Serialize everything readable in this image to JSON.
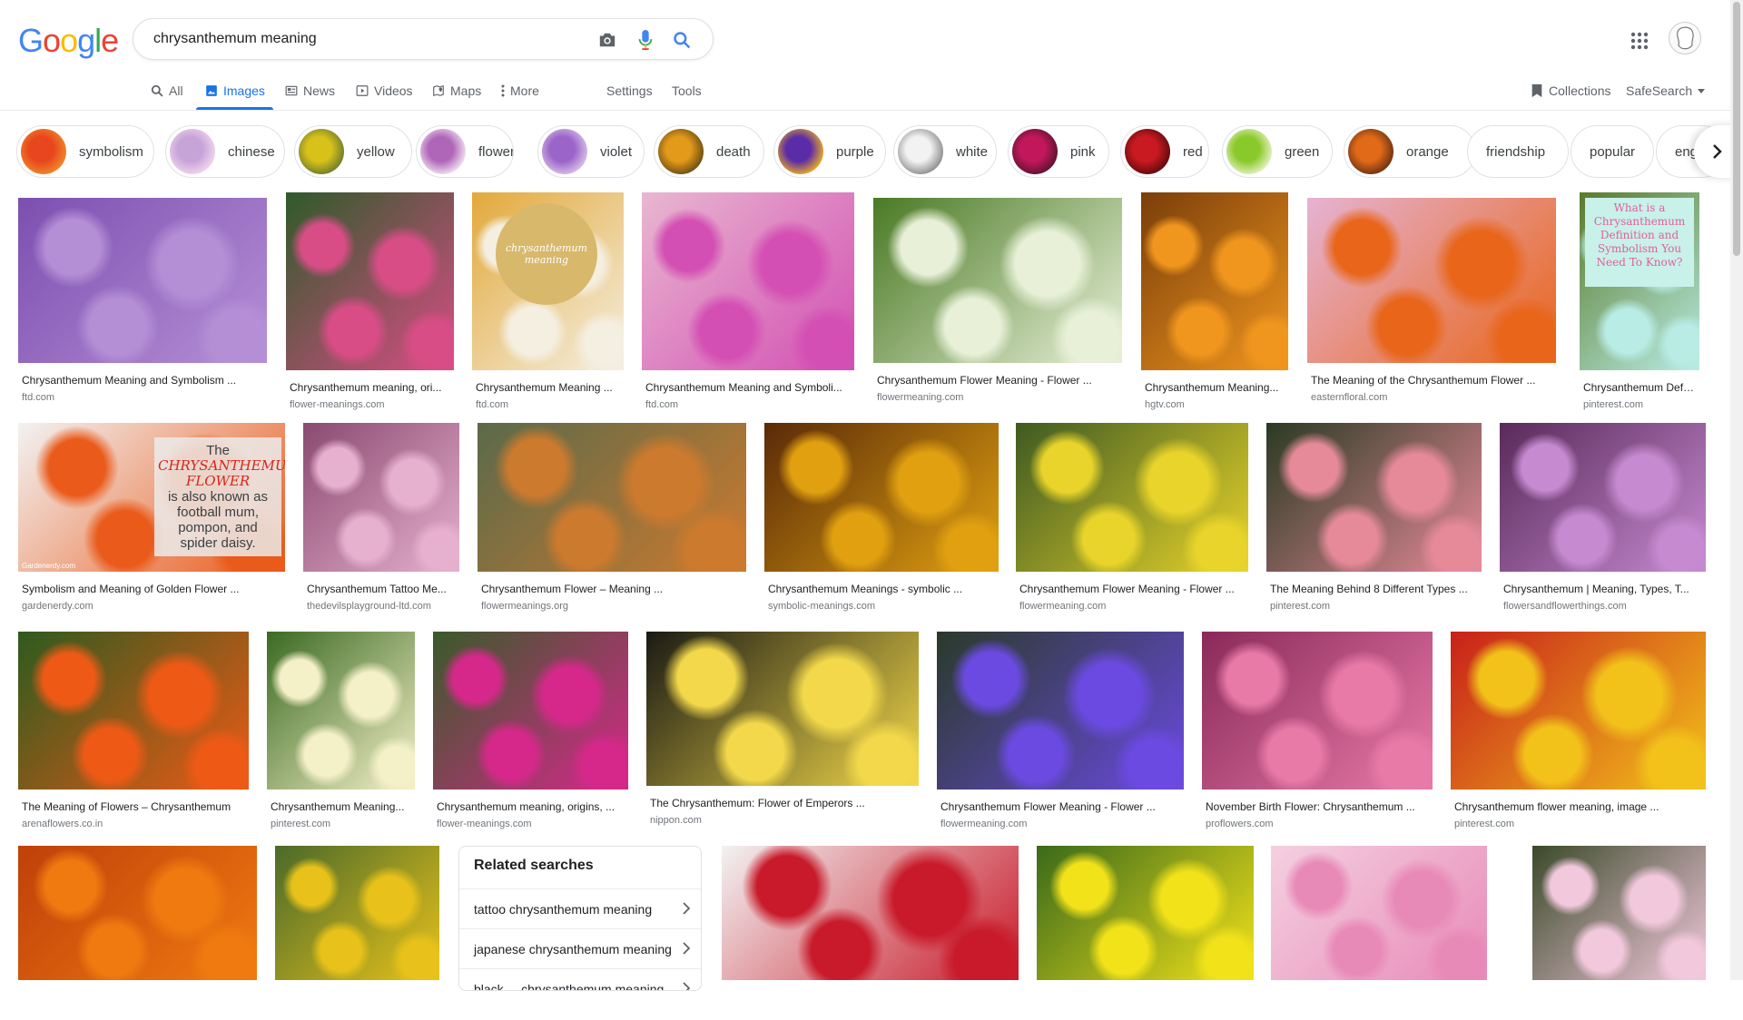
{
  "logo": {
    "letters": [
      "G",
      "o",
      "o",
      "g",
      "l",
      "e"
    ],
    "colors": [
      "#4285f4",
      "#ea4335",
      "#fbbc05",
      "#4285f4",
      "#34a853",
      "#ea4335"
    ]
  },
  "search": {
    "query": "chrysanthemum meaning",
    "placeholder": ""
  },
  "icons": {
    "camera": "camera-icon",
    "mic": "mic-icon",
    "search": "search-icon",
    "apps": "apps-grid-icon"
  },
  "tabs": [
    {
      "label": "All",
      "icon": "search-icon"
    },
    {
      "label": "Images",
      "icon": "image-icon",
      "active": true
    },
    {
      "label": "News",
      "icon": "news-icon"
    },
    {
      "label": "Videos",
      "icon": "video-icon"
    },
    {
      "label": "Maps",
      "icon": "map-icon"
    },
    {
      "label": "More",
      "icon": "more-vert-icon"
    },
    {
      "label": "Settings"
    },
    {
      "label": "Tools"
    }
  ],
  "right_tools": {
    "collections": "Collections",
    "safesearch": "SafeSearch"
  },
  "chips": [
    {
      "label": "symbolism",
      "colors": [
        "#e8461e",
        "#f08a2a"
      ]
    },
    {
      "label": "chinese",
      "colors": [
        "#c7a4d8",
        "#f2d7ee"
      ]
    },
    {
      "label": "yellow",
      "colors": [
        "#d8c21a",
        "#6c7a2a"
      ]
    },
    {
      "label": "flower",
      "colors": [
        "#b066b8",
        "#f3e6f4"
      ]
    },
    {
      "label": "violet",
      "colors": [
        "#9b64c8",
        "#d9c2ea"
      ]
    },
    {
      "label": "death",
      "colors": [
        "#e39a1a",
        "#6a4a12"
      ]
    },
    {
      "label": "purple",
      "colors": [
        "#5b2ca8",
        "#f0b020"
      ]
    },
    {
      "label": "white",
      "colors": [
        "#f2f2f2",
        "#8a8a8a"
      ]
    },
    {
      "label": "pink",
      "colors": [
        "#c2185b",
        "#5a1230"
      ]
    },
    {
      "label": "red",
      "colors": [
        "#c81a20",
        "#5b0a0e"
      ]
    },
    {
      "label": "green",
      "colors": [
        "#8ac92a",
        "#e8f2c8"
      ]
    },
    {
      "label": "orange",
      "colors": [
        "#e06a18",
        "#6a3012"
      ]
    },
    {
      "label": "friendship"
    },
    {
      "label": "popular"
    },
    {
      "label": "eng"
    }
  ],
  "results": [
    {
      "title": "Chrysanthemum Meaning and Symbolism ...",
      "source": "ftd.com",
      "colors": [
        "#b58fd6",
        "#7c4fb0"
      ]
    },
    {
      "title": "Chrysanthemum meaning, ori...",
      "source": "flower-meanings.com",
      "colors": [
        "#d94d86",
        "#2f5a2a"
      ]
    },
    {
      "title": "Chrysanthemum Meaning ...",
      "source": "ftd.com",
      "colors": [
        "#f5efe2",
        "#e2a93b"
      ]
    },
    {
      "title": "Chrysanthemum Meaning and Symboli...",
      "source": "ftd.com",
      "colors": [
        "#d34fb3",
        "#e8b7d0"
      ]
    },
    {
      "title": "Chrysanthemum Flower Meaning - Flower ...",
      "source": "flowermeaning.com",
      "colors": [
        "#e8f0d8",
        "#4a7a24"
      ]
    },
    {
      "title": "Chrysanthemum Meaning...",
      "source": "hgtv.com",
      "colors": [
        "#f0961e",
        "#7a3e0a"
      ]
    },
    {
      "title": "The Meaning of the Chrysanthemum Flower ...",
      "source": "easternfloral.com",
      "colors": [
        "#e8651a",
        "#e6b3d2"
      ]
    },
    {
      "title": "Chrysanthemum Defin...",
      "source": "pinterest.com",
      "colors": [
        "#b8ece4",
        "#5a7a2a"
      ]
    },
    {
      "title": "Symbolism and Meaning of Golden Flower ...",
      "source": "gardenerdy.com",
      "colors": [
        "#ea5a1a",
        "#f2f2f2"
      ]
    },
    {
      "title": "Chrysanthemum Tattoo Me...",
      "source": "thedevilsplayground-ltd.com",
      "colors": [
        "#e6b0cf",
        "#8a4a70"
      ]
    },
    {
      "title": "Chrysanthemum Flower – Meaning ...",
      "source": "flowermeanings.org",
      "colors": [
        "#cc7a2e",
        "#5a6a4a"
      ]
    },
    {
      "title": "Chrysanthemum Meanings - symbolic ...",
      "source": "symbolic-meanings.com",
      "colors": [
        "#e0a010",
        "#5a2a08"
      ]
    },
    {
      "title": "Chrysanthemum Flower Meaning - Flower ...",
      "source": "flowermeaning.com",
      "colors": [
        "#e8d42a",
        "#3e5a22"
      ]
    },
    {
      "title": "The Meaning Behind 8 Different Types ...",
      "source": "pinterest.com",
      "colors": [
        "#e68a9a",
        "#2a3a22"
      ]
    },
    {
      "title": "Chrysanthemum | Meaning, Types, T...",
      "source": "flowersandflowerthings.com",
      "colors": [
        "#c58ad0",
        "#5a2a5a"
      ]
    },
    {
      "title": "The Meaning of Flowers – Chrysanthemum",
      "source": "arenaflowers.co.in",
      "colors": [
        "#ee5a16",
        "#2e5a1e"
      ]
    },
    {
      "title": "Chrysanthemum Meaning...",
      "source": "pinterest.com",
      "colors": [
        "#f4f0c8",
        "#3a6a22"
      ]
    },
    {
      "title": "Chrysanthemum meaning, origins, ...",
      "source": "flower-meanings.com",
      "colors": [
        "#d6288a",
        "#3a5a2a"
      ]
    },
    {
      "title": "The Chrysanthemum: Flower of Emperors ...",
      "source": "nippon.com",
      "colors": [
        "#f2d84a",
        "#1a1a14"
      ]
    },
    {
      "title": "Chrysanthemum Flower Meaning - Flower ...",
      "source": "flowermeaning.com",
      "colors": [
        "#6a4ae0",
        "#2a3a2a"
      ]
    },
    {
      "title": "November Birth Flower: Chrysanthemum ...",
      "source": "proflowers.com",
      "colors": [
        "#e87aa8",
        "#8a2a5a"
      ]
    },
    {
      "title": "Chrysanthemum flower meaning, image ...",
      "source": "pinterest.com",
      "colors": [
        "#f2c21a",
        "#c8201a"
      ]
    },
    {
      "title": "",
      "source": "",
      "colors": [
        "#f07a10",
        "#c0400a"
      ]
    },
    {
      "title": "",
      "source": "",
      "colors": [
        "#e8c21a",
        "#4a6a2a"
      ]
    },
    {
      "title": "",
      "source": "",
      "colors": [
        "#c81a2a",
        "#f2f2f2"
      ]
    },
    {
      "title": "",
      "source": "",
      "colors": [
        "#f2e21a",
        "#3a6a1a"
      ]
    },
    {
      "title": "",
      "source": "",
      "colors": [
        "#e88ab8",
        "#f4d0e0"
      ]
    },
    {
      "title": "",
      "source": "",
      "colors": [
        "#f2c8dc",
        "#3a4a2a"
      ]
    }
  ],
  "image_text": {
    "ftd_circle": "chrysanthemum meaning",
    "pinterest_overlay": "What is a Chrysanthemum Definition and Symbolism You Need To Know?",
    "gardenerdy_overlay": [
      "The",
      "CHRYSANTHEMUM",
      "FLOWER",
      "is also known as",
      "football mum,",
      "pompon, and",
      "spider daisy."
    ],
    "gardenerdy_watermark": "Gardenerdy.com"
  },
  "related_searches": {
    "heading": "Related searches",
    "items": [
      "tattoo chrysanthemum meaning",
      "japanese chrysanthemum meaning",
      "black ... chrysanthemum meaning"
    ]
  }
}
